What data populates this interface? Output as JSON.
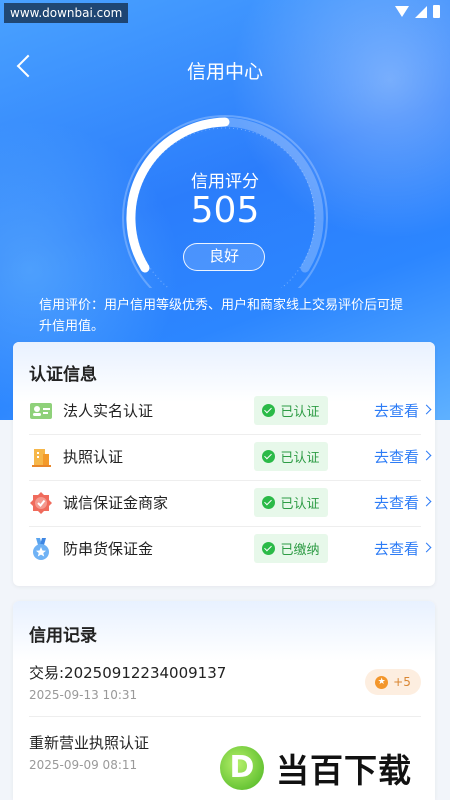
{
  "status_bar": {
    "watermark": "www.downbai.com"
  },
  "nav": {
    "title": "信用中心"
  },
  "score": {
    "label": "信用评分",
    "value": "505",
    "level": "良好",
    "description": "信用评价：用户信用等级优秀、用户和商家线上交易评价后可提升信用值。"
  },
  "auth_section": {
    "title": "认证信息",
    "items": [
      {
        "label": "法人实名认证",
        "icon": "id-card-icon",
        "status": "已认证",
        "action": "去查看"
      },
      {
        "label": "执照认证",
        "icon": "license-building-icon",
        "status": "已认证",
        "action": "去查看"
      },
      {
        "label": "诚信保证金商家",
        "icon": "guarantee-badge-icon",
        "status": "已认证",
        "action": "去查看"
      },
      {
        "label": "防串货保证金",
        "icon": "medal-icon",
        "status": "已缴纳",
        "action": "去查看"
      }
    ]
  },
  "records_section": {
    "title": "信用记录",
    "items": [
      {
        "title": "交易:20250912234009137",
        "time": "2025-09-13 10:31",
        "points": "+5"
      },
      {
        "title": "重新营业执照认证",
        "time": "2025-09-09 08:11"
      }
    ]
  },
  "brand_watermark": {
    "logo_letter": "D",
    "text": "当百下载"
  },
  "colors": {
    "accent": "#2d7cf6",
    "success": "#2bba48",
    "points": "#f3962b"
  }
}
